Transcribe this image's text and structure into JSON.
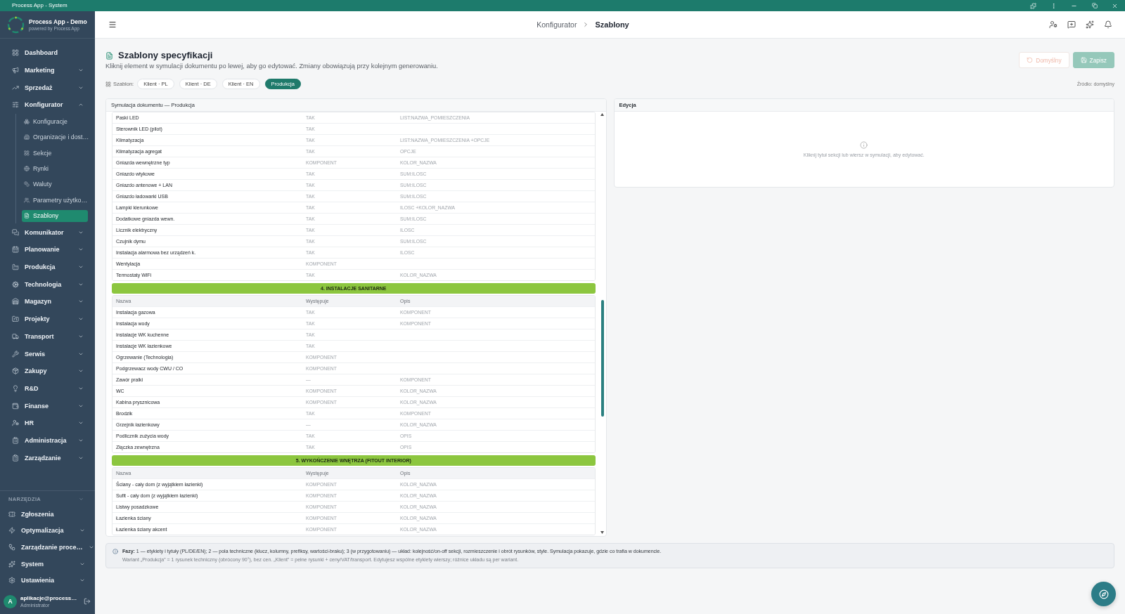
{
  "window": {
    "title": "Process App - System"
  },
  "sidebar": {
    "brand": {
      "name": "Process App - Demo",
      "tagline": "powered by Process App"
    },
    "items": [
      {
        "label": "Dashboard",
        "kind": "link",
        "selected": false
      },
      {
        "label": "Marketing",
        "kind": "group",
        "expanded": false,
        "selected": false
      },
      {
        "label": "Sprzedaż",
        "kind": "group",
        "expanded": false,
        "selected": false
      },
      {
        "label": "Konfigurator",
        "kind": "group",
        "expanded": true,
        "selected": false,
        "children": [
          {
            "label": "Konfiguracje",
            "selected": false
          },
          {
            "label": "Organizacje i dost…",
            "selected": false
          },
          {
            "label": "Sekcje",
            "selected": false
          },
          {
            "label": "Rynki",
            "selected": false
          },
          {
            "label": "Waluty",
            "selected": false
          },
          {
            "label": "Parametry użytko…",
            "selected": false
          },
          {
            "label": "Szablony",
            "selected": true
          }
        ]
      },
      {
        "label": "Komunikator",
        "kind": "group",
        "expanded": false,
        "selected": false
      },
      {
        "label": "Planowanie",
        "kind": "group",
        "expanded": false,
        "selected": false
      },
      {
        "label": "Produkcja",
        "kind": "group",
        "expanded": false,
        "selected": false
      },
      {
        "label": "Technologia",
        "kind": "group",
        "expanded": false,
        "selected": false
      },
      {
        "label": "Magazyn",
        "kind": "group",
        "expanded": false,
        "selected": false
      },
      {
        "label": "Projekty",
        "kind": "group",
        "expanded": false,
        "selected": false
      },
      {
        "label": "Transport",
        "kind": "group",
        "expanded": false,
        "selected": false
      },
      {
        "label": "Serwis",
        "kind": "group",
        "expanded": false,
        "selected": false
      },
      {
        "label": "Zakupy",
        "kind": "group",
        "expanded": false,
        "selected": false
      },
      {
        "label": "R&D",
        "kind": "group",
        "expanded": false,
        "selected": false
      },
      {
        "label": "Finanse",
        "kind": "group",
        "expanded": false,
        "selected": false
      },
      {
        "label": "HR",
        "kind": "group",
        "expanded": false,
        "selected": false
      },
      {
        "label": "Administracja",
        "kind": "group",
        "expanded": false,
        "selected": false
      },
      {
        "label": "Zarządzanie",
        "kind": "group",
        "expanded": false,
        "selected": false
      }
    ],
    "tools": {
      "heading": "NARZĘDZIA",
      "items": [
        {
          "label": "Zgłoszenia",
          "kind": "link",
          "selected": false
        },
        {
          "label": "Optymalizacja",
          "kind": "group",
          "expanded": false,
          "selected": false
        },
        {
          "label": "Zarządzanie proce…",
          "kind": "group",
          "expanded": false,
          "selected": false
        },
        {
          "label": "System",
          "kind": "group",
          "expanded": false,
          "selected": false
        },
        {
          "label": "Ustawienia",
          "kind": "group",
          "expanded": false,
          "selected": false
        }
      ]
    },
    "user": {
      "initial": "A",
      "name": "aplikacje@process…",
      "role": "Administrator"
    }
  },
  "header": {
    "breadcrumb": [
      {
        "label": "Konfigurator",
        "current": false
      },
      {
        "label": "Szablony",
        "current": true
      }
    ]
  },
  "page": {
    "title": "Szablony specyfikacji",
    "subtitle": "Kliknij element w symulacji dokumentu po lewej, aby go edytować. Zmiany obowiązują przy kolejnym generowaniu.",
    "actions": [
      {
        "label": "Domyślny",
        "kind": "reset",
        "disabled": true
      },
      {
        "label": "Zapisz",
        "kind": "save",
        "disabled": true
      }
    ],
    "template": {
      "label": "Szablon:",
      "options": [
        {
          "label": "Klient · PL",
          "selected": false
        },
        {
          "label": "Klient · DE",
          "selected": false
        },
        {
          "label": "Klient · EN",
          "selected": false
        },
        {
          "label": "Produkcja",
          "selected": true
        }
      ],
      "source": "Źródło: domyślny"
    }
  },
  "simulation": {
    "title": "Symulacja dokumentu — Produkcja",
    "sections": [
      {
        "rows": [
          {
            "name": "Paski LED",
            "occurs": "TAK",
            "description": "LIST:NAZWA_POMIESZCZENIA"
          },
          {
            "name": "Sterownik LED (pilot)",
            "occurs": "TAK"
          },
          {
            "name": "Klimatyzacja",
            "occurs": "TAK",
            "description": "LIST:NAZWA_POMIESZCZENIA +OPCJE"
          },
          {
            "name": "Klimatyzacja agregat",
            "occurs": "TAK",
            "description": "OPCJE"
          },
          {
            "name": "Gniazda wewnętrzne typ",
            "occurs": "KOMPONENT",
            "description": "KOLOR_NAZWA"
          },
          {
            "name": "Gniazdo wtykowe",
            "occurs": "TAK",
            "description": "SUM:ILOSC"
          },
          {
            "name": "Gniazdo antenowe + LAN",
            "occurs": "TAK",
            "description": "SUM:ILOSC"
          },
          {
            "name": "Gniazdo ładowarki USB",
            "occurs": "TAK",
            "description": "SUM:ILOSC"
          },
          {
            "name": "Lampki kierunkowe",
            "occurs": "TAK",
            "description": "ILOSC +KOLOR_NAZWA"
          },
          {
            "name": "Dodatkowe gniazda wewn.",
            "occurs": "TAK",
            "description": "SUM:ILOSC"
          },
          {
            "name": "Licznik elektryczny",
            "occurs": "TAK",
            "description": "ILOSC"
          },
          {
            "name": "Czujnik dymu",
            "occurs": "TAK",
            "description": "SUM:ILOSC"
          },
          {
            "name": "Instalacja alarmowa bez urządzeń k.",
            "occurs": "TAK",
            "description": "ILOSC"
          },
          {
            "name": "Wentylacja",
            "occurs": "KOMPONENT"
          },
          {
            "name": "Termostaty WiFi",
            "occurs": "TAK",
            "description": "KOLOR_NAZWA"
          }
        ]
      },
      {
        "title": "4. INSTALACJE SANITARNE",
        "columns": [
          "Nazwa",
          "Występuje",
          "Opis"
        ],
        "rows": [
          {
            "name": "Instalacja gazowa",
            "occurs": "TAK",
            "description": "KOMPONENT"
          },
          {
            "name": "Instalacja wody",
            "occurs": "TAK",
            "description": "KOMPONENT"
          },
          {
            "name": "Instalacje WK kuchenne",
            "occurs": "TAK"
          },
          {
            "name": "Instalacje WK łazienkowe",
            "occurs": "TAK"
          },
          {
            "name": "Ogrzewanie (Technologia)",
            "occurs": "KOMPONENT"
          },
          {
            "name": "Podgrzewacz wody CWU / CO",
            "occurs": "KOMPONENT"
          },
          {
            "name": "Zawór pralki",
            "occurs": "—",
            "description": "KOMPONENT"
          },
          {
            "name": "WC",
            "occurs": "KOMPONENT",
            "description": "KOLOR_NAZWA"
          },
          {
            "name": "Kabina prysznicowa",
            "occurs": "KOMPONENT",
            "description": "KOLOR_NAZWA"
          },
          {
            "name": "Brodzik",
            "occurs": "TAK",
            "description": "KOMPONENT"
          },
          {
            "name": "Grzejnik łazienkowy",
            "occurs": "—",
            "description": "KOLOR_NAZWA"
          },
          {
            "name": "Podlicznik zużycia wody",
            "occurs": "TAK",
            "description": "OPIS"
          },
          {
            "name": "Złączka zewnętrzna",
            "occurs": "TAK",
            "description": "OPIS"
          }
        ]
      },
      {
        "title": "5. WYKOŃCZENIE WNĘTRZA (FITOUT INTERIOR)",
        "columns": [
          "Nazwa",
          "Występuje",
          "Opis"
        ],
        "rows": [
          {
            "name": "Ściany - cały dom (z wyjątkiem łazienki)",
            "occurs": "KOMPONENT",
            "description": "KOLOR_NAZWA"
          },
          {
            "name": "Sufit - cały dom (z wyjątkiem łazienki)",
            "occurs": "KOMPONENT",
            "description": "KOLOR_NAZWA"
          },
          {
            "name": "Listwy posadzkowe",
            "occurs": "KOMPONENT",
            "description": "KOLOR_NAZWA"
          },
          {
            "name": "Łazienka ściany",
            "occurs": "KOMPONENT",
            "description": "KOLOR_NAZWA"
          },
          {
            "name": "Łazienka ściany akcent",
            "occurs": "KOMPONENT",
            "description": "KOLOR_NAZWA"
          }
        ]
      }
    ]
  },
  "editor": {
    "title": "Edycja",
    "hint": "Kliknij tytuł sekcji lub wiersz w symulacji, aby edytować."
  },
  "note": {
    "text": "**Fazy:** 1 — etykiety i tytuły (PL/DE/EN); 2 — pola techniczne (klucz, kolumny, prefiksy, wartości-braku); 3 (w przygotowaniu) — układ: kolejność/on-off sekcji, rozmieszczenie i obrót rysunków, style. Symulacja pokazuje, gdzie co trafia w dokumencie.",
    "detail": "Wariant „Produkcja” = 1 rysunek techniczny (obrócony 90°), bez cen. „Klient” = pełne rysunki + ceny/VAT/transport. Edytujesz wspólne etykiety wierszy; różnice układu są per wariant."
  }
}
